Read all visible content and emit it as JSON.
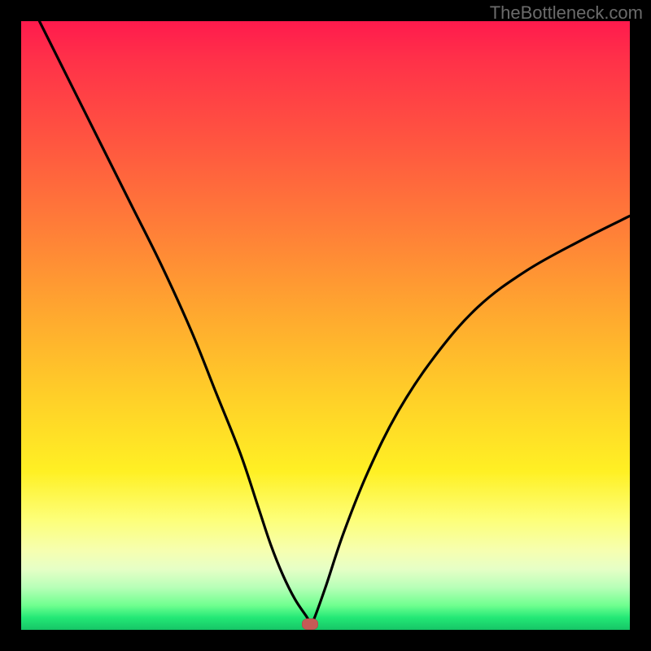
{
  "watermark": "TheBottleneck.com",
  "chart_data": {
    "type": "line",
    "title": "",
    "xlabel": "",
    "ylabel": "",
    "xlim": [
      0,
      100
    ],
    "ylim": [
      0,
      100
    ],
    "series": [
      {
        "name": "bottleneck-curve",
        "x": [
          3,
          8,
          13,
          18,
          23,
          28,
          32,
          36,
          39,
          41,
          43,
          45,
          47,
          47.5,
          48,
          50,
          53,
          57,
          62,
          68,
          75,
          83,
          92,
          100
        ],
        "y": [
          100,
          90,
          80,
          70,
          60,
          49,
          39,
          29,
          20,
          14,
          9,
          5,
          2,
          1,
          1.5,
          7,
          16,
          26,
          36,
          45,
          53,
          59,
          64,
          68
        ]
      }
    ],
    "marker": {
      "x": 47.5,
      "y": 1,
      "color": "#c65a56"
    },
    "background_gradient": {
      "direction": "vertical",
      "stops": [
        {
          "pos": 0.0,
          "color": "#ff1a4d"
        },
        {
          "pos": 0.48,
          "color": "#ffa82f"
        },
        {
          "pos": 0.82,
          "color": "#fdff7a"
        },
        {
          "pos": 1.0,
          "color": "#16c566"
        }
      ]
    }
  }
}
